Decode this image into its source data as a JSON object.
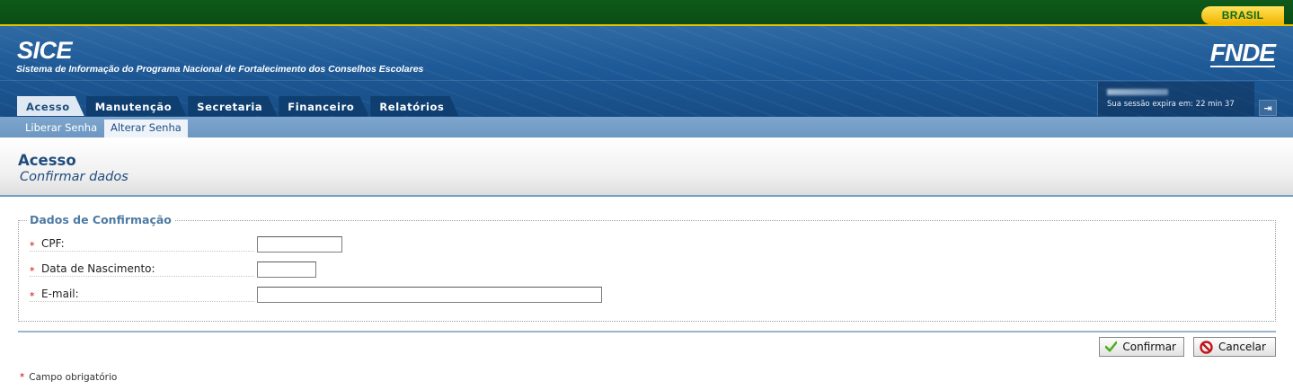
{
  "gov_bar": {
    "badge": "BRASIL"
  },
  "header": {
    "title": "SICE",
    "subtitle": "Sistema de Informação do Programa Nacional de Fortalecimento dos Conselhos Escolares",
    "logo": "FNDE",
    "session_user_obscured": "SICE_00797629040",
    "session_text": "Sua sessão expira em: 22 min 37",
    "logout_icon": "logout-icon"
  },
  "tabs": [
    {
      "label": "Acesso",
      "active": true
    },
    {
      "label": "Manutenção",
      "active": false
    },
    {
      "label": "Secretaria",
      "active": false
    },
    {
      "label": "Financeiro",
      "active": false
    },
    {
      "label": "Relatórios",
      "active": false
    }
  ],
  "subnav": [
    {
      "label": "Liberar Senha",
      "active": false
    },
    {
      "label": "Alterar Senha",
      "active": true
    }
  ],
  "page": {
    "title": "Acesso",
    "subtitle": "Confirmar dados"
  },
  "form": {
    "legend": "Dados de Confirmação",
    "required_mark": "*",
    "fields": [
      {
        "label": "CPF:",
        "value": ""
      },
      {
        "label": "Data de Nascimento:",
        "value": ""
      },
      {
        "label": "E-mail:",
        "value": ""
      }
    ]
  },
  "buttons": {
    "confirm": "Confirmar",
    "cancel": "Cancelar"
  },
  "footnote": {
    "mark": "*",
    "text": "Campo obrigatório"
  },
  "colors": {
    "gov_green": "#0e5a1a",
    "header_blue": "#1e5a97",
    "accent_blue": "#1f4c7d",
    "required_red": "#cc0000"
  }
}
